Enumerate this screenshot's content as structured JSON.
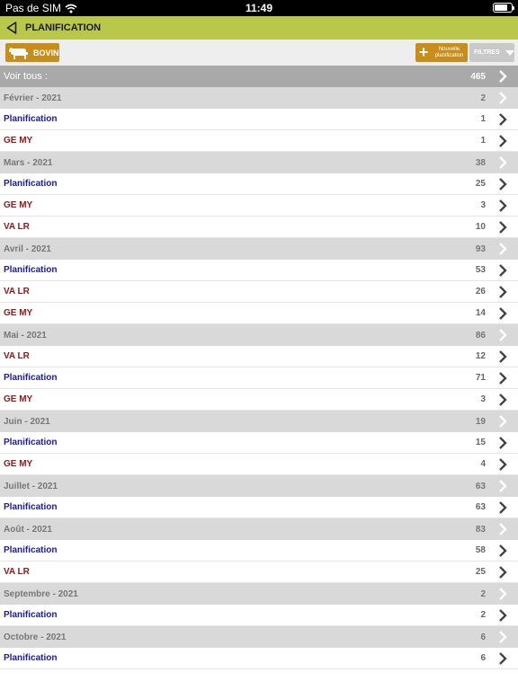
{
  "status": {
    "carrier": "Pas de SIM",
    "time": "11:49",
    "battery_level": 0.8
  },
  "nav": {
    "title": "PLANIFICATION"
  },
  "toolbar": {
    "species_label": "BOVIN",
    "new_label_line1": "Nouvelle",
    "new_label_line2": "planification",
    "filter_label": "FILTRES"
  },
  "colors": {
    "accent": "#b9c84a",
    "button": "#c98e1a",
    "blue_type": "#1a1aa8",
    "red_type": "#8b1a1a"
  },
  "list": [
    {
      "kind": "all",
      "label": "Voir tous :",
      "count": "465"
    },
    {
      "kind": "month",
      "label": "Février - 2021",
      "count": "2"
    },
    {
      "kind": "sub",
      "color": "blue",
      "label": "Planification",
      "count": "1"
    },
    {
      "kind": "sub",
      "color": "red",
      "label": "GE MY",
      "count": "1"
    },
    {
      "kind": "month",
      "label": "Mars - 2021",
      "count": "38"
    },
    {
      "kind": "sub",
      "color": "blue",
      "label": "Planification",
      "count": "25"
    },
    {
      "kind": "sub",
      "color": "red",
      "label": "GE MY",
      "count": "3"
    },
    {
      "kind": "sub",
      "color": "red",
      "label": "VA LR",
      "count": "10"
    },
    {
      "kind": "month",
      "label": "Avril - 2021",
      "count": "93"
    },
    {
      "kind": "sub",
      "color": "blue",
      "label": "Planification",
      "count": "53"
    },
    {
      "kind": "sub",
      "color": "red",
      "label": "VA LR",
      "count": "26"
    },
    {
      "kind": "sub",
      "color": "red",
      "label": "GE MY",
      "count": "14"
    },
    {
      "kind": "month",
      "label": "Mai - 2021",
      "count": "86"
    },
    {
      "kind": "sub",
      "color": "red",
      "label": "VA LR",
      "count": "12"
    },
    {
      "kind": "sub",
      "color": "blue",
      "label": "Planification",
      "count": "71"
    },
    {
      "kind": "sub",
      "color": "red",
      "label": "GE MY",
      "count": "3"
    },
    {
      "kind": "month",
      "label": "Juin - 2021",
      "count": "19"
    },
    {
      "kind": "sub",
      "color": "blue",
      "label": "Planification",
      "count": "15"
    },
    {
      "kind": "sub",
      "color": "red",
      "label": "GE MY",
      "count": "4"
    },
    {
      "kind": "month",
      "label": "Juillet - 2021",
      "count": "63"
    },
    {
      "kind": "sub",
      "color": "blue",
      "label": "Planification",
      "count": "63"
    },
    {
      "kind": "month",
      "label": "Août - 2021",
      "count": "83"
    },
    {
      "kind": "sub",
      "color": "blue",
      "label": "Planification",
      "count": "58"
    },
    {
      "kind": "sub",
      "color": "red",
      "label": "VA LR",
      "count": "25"
    },
    {
      "kind": "month",
      "label": "Septembre - 2021",
      "count": "2"
    },
    {
      "kind": "sub",
      "color": "blue",
      "label": "Planification",
      "count": "2"
    },
    {
      "kind": "month",
      "label": "Octobre - 2021",
      "count": "6"
    },
    {
      "kind": "sub",
      "color": "blue",
      "label": "Planification",
      "count": "6"
    }
  ]
}
